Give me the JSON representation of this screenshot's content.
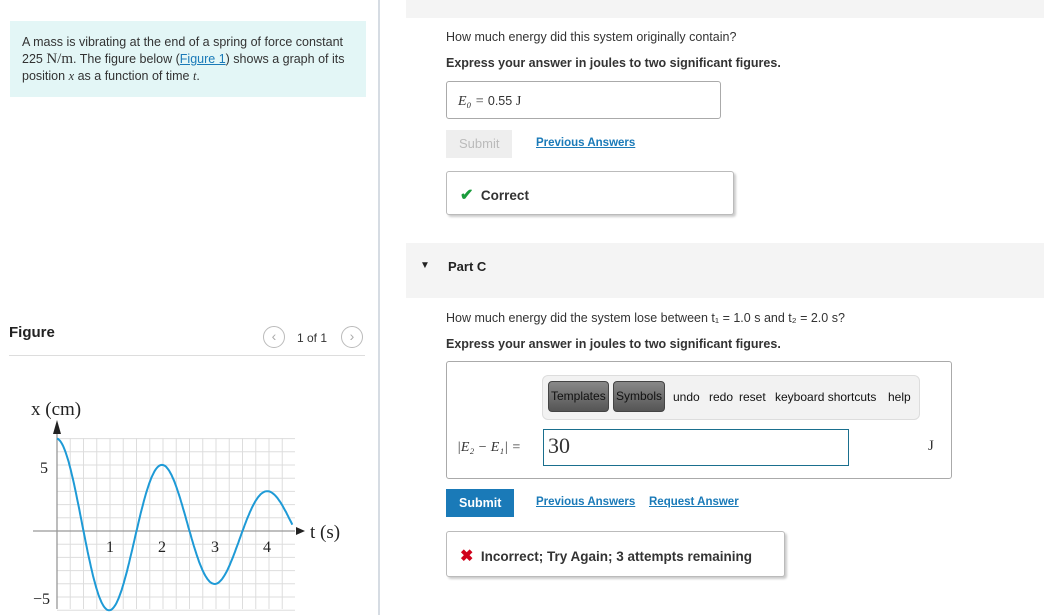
{
  "problem": {
    "text_before": "A mass is vibrating at the end of a spring of force constant 225 ",
    "unit": "N/m",
    "text_mid": ". The figure below (",
    "figure_link": "Figure 1",
    "text_after": ") shows a graph of its position ",
    "var_x": "x",
    "text_end": " as a function of time ",
    "var_t": "t",
    "period": "."
  },
  "figure": {
    "title": "Figure",
    "pager": "1 of 1",
    "prev_icon": "chevron-left-icon",
    "next_icon": "chevron-right-icon",
    "y_label": "x (cm)",
    "x_label": "t (s)",
    "y_ticks": [
      "5",
      "−5"
    ],
    "x_ticks": [
      "1",
      "2",
      "3",
      "4"
    ],
    "curve_color": "#1e9ad6"
  },
  "partB": {
    "question": "How much energy did this system originally contain?",
    "instruction": "Express your answer in joules to two significant figures.",
    "answer_label": "E₀ = ",
    "answer_value": "0.55",
    "answer_unit": "J",
    "submit": "Submit",
    "previous_answers": "Previous Answers",
    "feedback": "Correct",
    "feedback_color": "#1a9c3c"
  },
  "partC": {
    "title": "Part C",
    "question_pre": "How much energy did the system lose between ",
    "t1": "t₁ = 1.0 s",
    "and": " and ",
    "t2": "t₂ = 2.0 s",
    "qmark": "?",
    "instruction": "Express your answer in joules to two significant figures.",
    "toolbar": {
      "templates": "Templates",
      "symbols": "Symbols",
      "undo": "undo",
      "redo": "redo",
      "reset": "reset",
      "shortcuts": "keyboard shortcuts",
      "help": "help"
    },
    "answer_label": "|E₂ − E₁| = ",
    "answer_value": "30",
    "answer_unit": "J",
    "submit": "Submit",
    "previous_answers": "Previous Answers",
    "request_answer": "Request Answer",
    "feedback": "Incorrect; Try Again; 3 attempts remaining",
    "accent": "#1a7ab8",
    "error_color": "#d0021b"
  }
}
